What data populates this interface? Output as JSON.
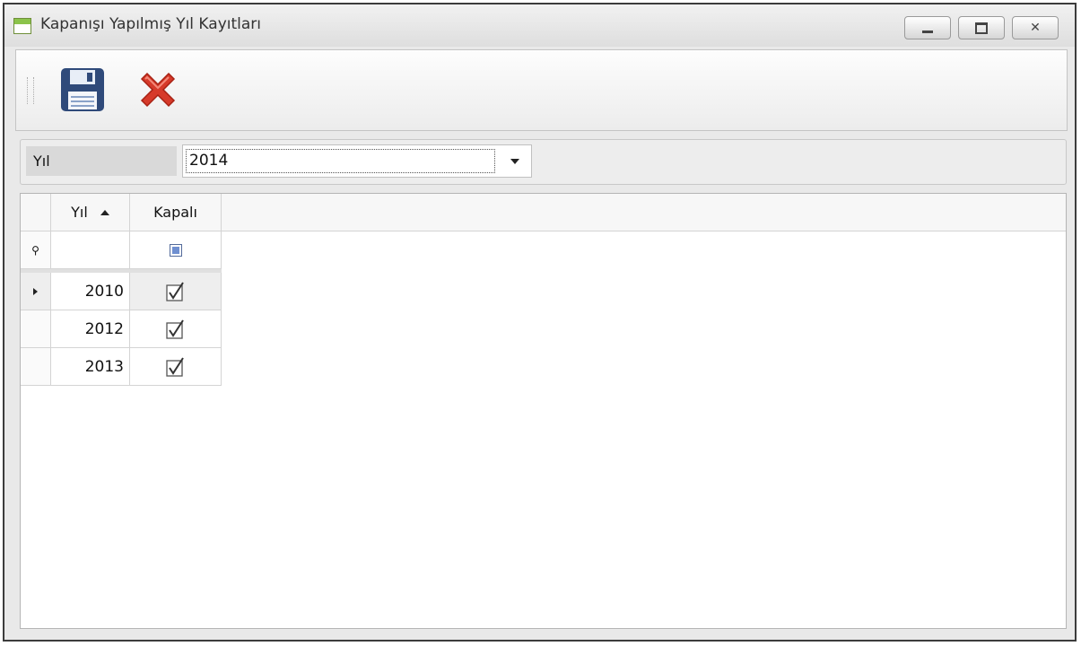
{
  "window": {
    "title": "Kapanışı Yapılmış Yıl Kayıtları"
  },
  "titlebar_buttons": {
    "minimize": "_",
    "maximize": "□",
    "close": "✕"
  },
  "toolbar": {
    "save_icon": "save-floppy-icon",
    "cancel_icon": "close-x-icon"
  },
  "filter": {
    "label": "Yıl",
    "value": "2014"
  },
  "grid": {
    "columns": [
      "Yıl",
      "Kapalı"
    ],
    "sort": "ascending",
    "rows": [
      {
        "yil": "2010",
        "kapali": true,
        "selected": true
      },
      {
        "yil": "2012",
        "kapali": true,
        "selected": false
      },
      {
        "yil": "2013",
        "kapali": true,
        "selected": false
      }
    ]
  },
  "colors": {
    "accent": "#8bc34a",
    "close_icon": "#d63a2a",
    "save_icon": "#2f4a7a"
  }
}
